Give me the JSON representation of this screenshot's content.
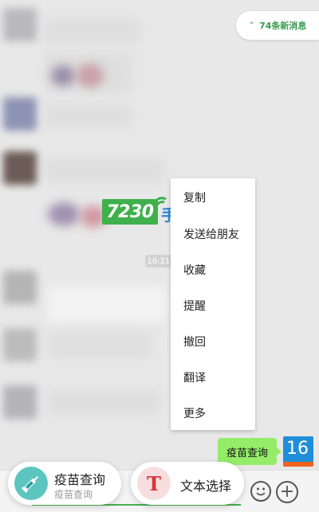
{
  "chat": {
    "new_messages": "74条新消息",
    "timestamp": "16:21"
  },
  "context_menu": {
    "items": [
      "复制",
      "发送给朋友",
      "收藏",
      "提醒",
      "撤回",
      "翻译",
      "更多"
    ]
  },
  "watermark": {
    "number": "7230",
    "text": "手游网"
  },
  "sent_message": {
    "text": "疫苗查询"
  },
  "my_avatar": {
    "label": "16"
  },
  "cards": {
    "vaccine": {
      "title": "疫苗查询",
      "subtitle": "疫苗查询"
    },
    "text_select": {
      "title": "文本选择",
      "icon_letter": "T"
    }
  },
  "colors": {
    "accent": "#48b04f",
    "bubble": "#95ec69",
    "menu_bg": "#ffffff"
  },
  "icons": [
    "chevron-up-double-icon",
    "syringe-icon",
    "text-t-icon",
    "emoji-icon",
    "plus-icon"
  ]
}
